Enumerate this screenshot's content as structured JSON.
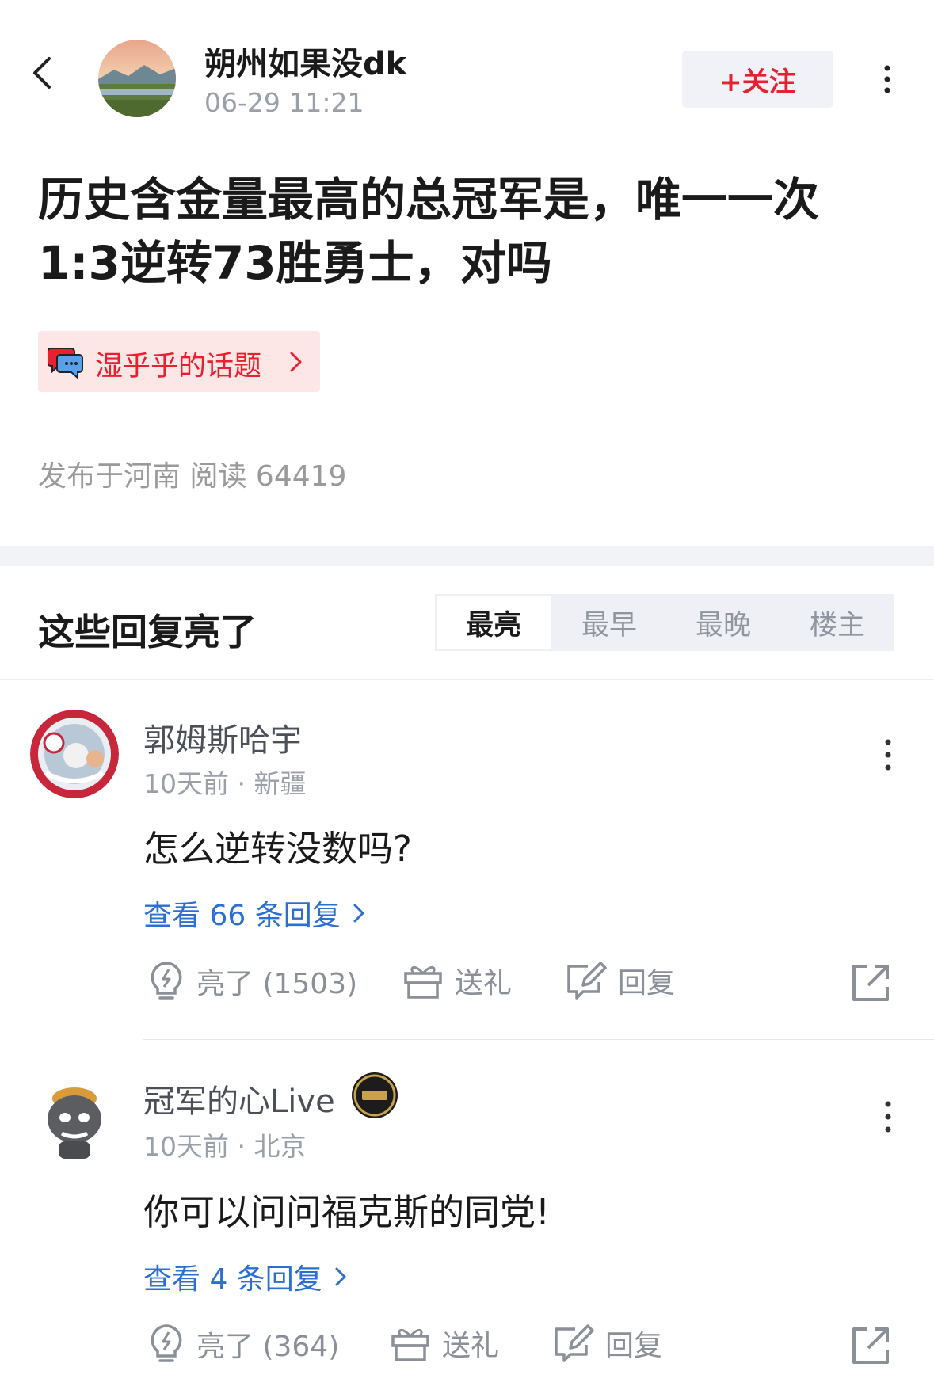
{
  "header": {
    "author_name": "朔州如果没dk",
    "post_time": "06-29 11:21",
    "follow_label": "+关注"
  },
  "post": {
    "title_line1": "历史含金量最高的总冠军是，唯一一次",
    "title_line2": "1:3逆转73胜勇士，对吗",
    "topic_label": "湿乎乎的话题",
    "meta": "发布于河南  阅读 64419"
  },
  "replies": {
    "section_title": "这些回复亮了",
    "tabs": [
      "最亮",
      "最早",
      "最晚",
      "楼主"
    ],
    "active_tab": "最亮",
    "items": [
      {
        "user": "郭姆斯哈宇",
        "meta": "10天前 · 新疆",
        "text": "怎么逆转没数吗?",
        "view_replies": "查看 66 条回复",
        "like": "亮了 (1503)",
        "gift": "送礼",
        "reply": "回复"
      },
      {
        "user": "冠军的心Live",
        "meta": "10天前 · 北京",
        "text": "你可以问问福克斯的同党!",
        "view_replies": "查看 4 条回复",
        "like": "亮了 (364)",
        "gift": "送礼",
        "reply": "回复"
      }
    ]
  },
  "colors": {
    "accent_red": "#e8202f",
    "link_blue": "#2c6fd1",
    "muted_gray": "#9aa0aa"
  },
  "icons": [
    "back-arrow-icon",
    "more-vertical-icon",
    "topic-chat-icon",
    "chevron-right-icon",
    "lightbulb-icon",
    "gift-icon",
    "edit-reply-icon",
    "share-icon"
  ]
}
